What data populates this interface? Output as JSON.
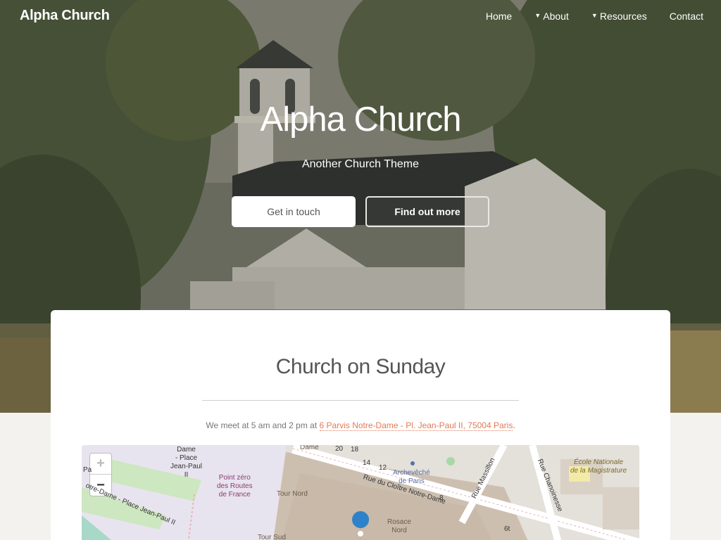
{
  "nav": {
    "brand": "Alpha Church",
    "items": [
      {
        "label": "Home",
        "dropdown": false
      },
      {
        "label": "About",
        "dropdown": true
      },
      {
        "label": "Resources",
        "dropdown": true
      },
      {
        "label": "Contact",
        "dropdown": false
      }
    ]
  },
  "hero": {
    "title": "Alpha Church",
    "subtitle": "Another Church Theme",
    "primary_button": "Get in touch",
    "secondary_button": "Find out more"
  },
  "section": {
    "title": "Church on Sunday",
    "text_before": "We meet at 5 am and 2 pm at ",
    "address": "6 Parvis Notre-Dame - Pl. Jean-Paul II, 75004 Paris",
    "text_after": "."
  },
  "map": {
    "zoom_in": "+",
    "zoom_out": "−",
    "labels": {
      "dame": "Dame",
      "place": "- Place",
      "jean_paul": "Jean-Paul",
      "ii": "II",
      "point_zero_1": "Point zéro",
      "point_zero_2": "des Routes",
      "point_zero_3": "de France",
      "tour_nord": "Tour Nord",
      "tour_sud": "Tour Sud",
      "archeveche_1": "Archevêché",
      "archeveche_2": "de Paris",
      "rosace_1": "Rosace",
      "rosace_2": "Nord",
      "ecole_1": "École Nationale",
      "ecole_2": "de la Magistrature",
      "street_cloitre": "Rue du Cloître Notre-Dame",
      "street_massillon": "Rue Massillon",
      "street_chanoinesse": "Rue Chanoinesse",
      "street_place": "otre-Dame - Place Jean-Paul II",
      "dame_top": "Dame",
      "n20": "20",
      "n18": "18",
      "n14": "14",
      "n12": "12",
      "n8": "8",
      "n6t": "6t",
      "pa": "Pa"
    }
  },
  "colors": {
    "accent": "#e07a5a",
    "card_bg": "#ffffff",
    "page_bg": "#f3f2ef"
  }
}
